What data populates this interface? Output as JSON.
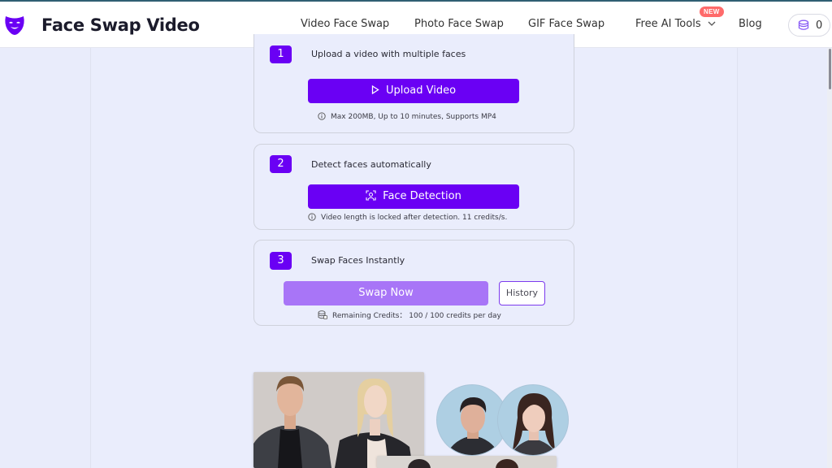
{
  "brand": {
    "name": "Face Swap Video"
  },
  "nav": {
    "links": [
      "Video Face Swap",
      "Photo Face Swap",
      "GIF Face Swap",
      "Free AI Tools",
      "Blog"
    ],
    "new_badge": "NEW",
    "credits": "0"
  },
  "steps": [
    {
      "number": "1",
      "title": "Upload a video with multiple faces",
      "button": "Upload Video",
      "note": "Max 200MB, Up to 10 minutes, Supports MP4"
    },
    {
      "number": "2",
      "title": "Detect faces automatically",
      "button": "Face Detection",
      "note": "Video length is locked after detection. 11 credits/s."
    },
    {
      "number": "3",
      "title": "Swap Faces Instantly",
      "button": "Swap Now",
      "secondary_button": "History",
      "note": "Remaining Credits： 100 / 100 credits per day"
    }
  ],
  "colors": {
    "accent": "#6a00f4",
    "accent_light": "#a875f7",
    "background": "#e9ecfb",
    "new_badge": "#ff6b6b"
  },
  "icons": [
    "mask-logo-icon",
    "chevron-down-icon",
    "coin-stack-icon",
    "play-icon",
    "face-scan-icon",
    "info-icon",
    "database-icon"
  ]
}
